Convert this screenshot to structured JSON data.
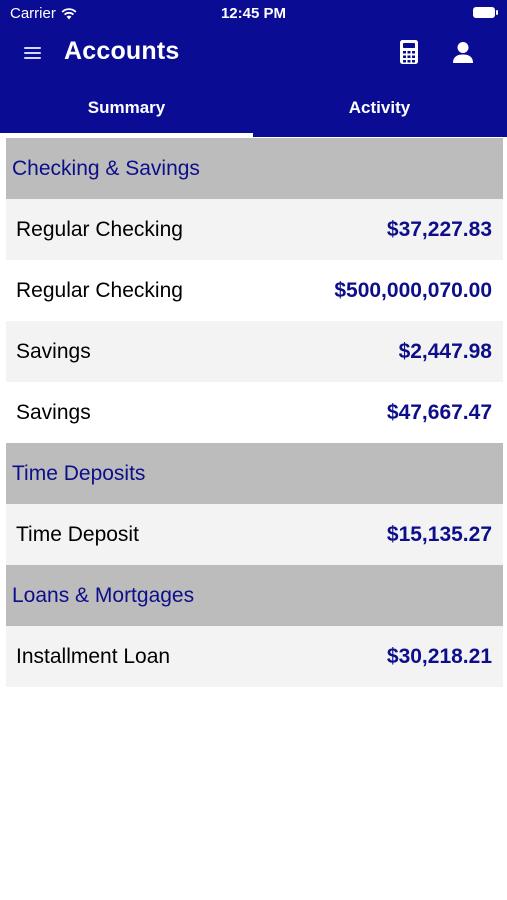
{
  "status_bar": {
    "carrier": "Carrier",
    "time": "12:45 PM"
  },
  "header": {
    "title": "Accounts",
    "background_color": "#0b0c94",
    "menu_icon": "hamburger-menu-icon",
    "calculator_icon": "calculator-icon",
    "profile_icon": "user-profile-icon"
  },
  "tabs": [
    {
      "label": "Summary",
      "active": true
    },
    {
      "label": "Activity",
      "active": false
    }
  ],
  "sections": [
    {
      "title": "Checking & Savings",
      "accounts": [
        {
          "name": "Regular Checking",
          "amount": "$37,227.83"
        },
        {
          "name": "Regular Checking",
          "amount": "$500,000,070.00"
        },
        {
          "name": "Savings",
          "amount": "$2,447.98"
        },
        {
          "name": "Savings",
          "amount": "$47,667.47"
        }
      ]
    },
    {
      "title": "Time Deposits",
      "accounts": [
        {
          "name": "Time Deposit",
          "amount": "$15,135.27"
        }
      ]
    },
    {
      "title": "Loans & Mortgages",
      "accounts": [
        {
          "name": "Installment Loan",
          "amount": "$30,218.21"
        }
      ]
    }
  ]
}
